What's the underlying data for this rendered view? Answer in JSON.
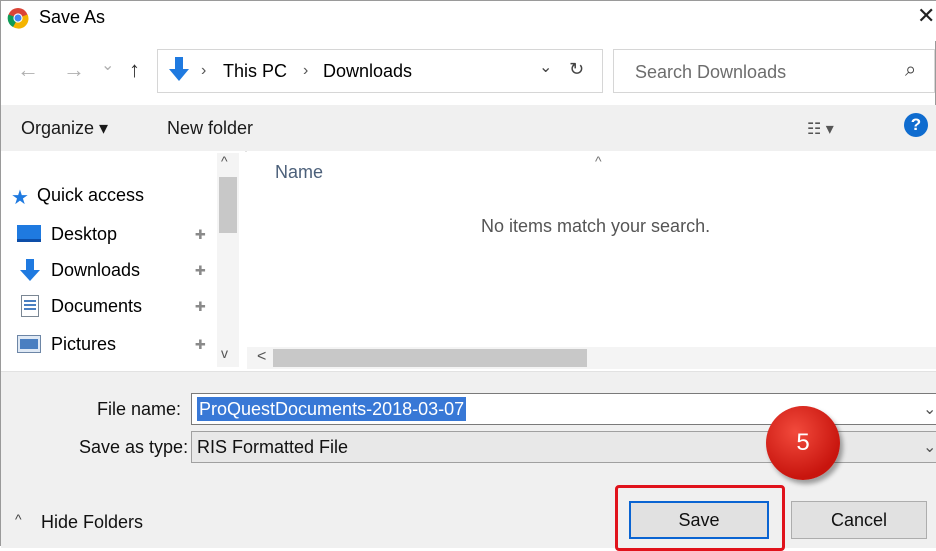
{
  "window": {
    "title": "Save As",
    "close_symbol": "✕"
  },
  "address_bar": {
    "back_symbol": "←",
    "forward_symbol": "→",
    "recent_symbol": "⌄",
    "up_symbol": "↑",
    "breadcrumbs": [
      "This PC",
      "Downloads"
    ],
    "separator": "›",
    "dropdown_symbol": "⌄",
    "refresh_symbol": "↻"
  },
  "search": {
    "placeholder": "Search Downloads",
    "icon": "⌕"
  },
  "toolbar": {
    "organize_label": "Organize ▾",
    "new_folder_label": "New folder",
    "view_symbol": "☷ ▾",
    "help_symbol": "?"
  },
  "nav_pane": {
    "items": [
      {
        "label": "Quick access",
        "icon": "star-icon"
      },
      {
        "label": "Desktop",
        "icon": "desktop-icon"
      },
      {
        "label": "Downloads",
        "icon": "download-arrow-icon"
      },
      {
        "label": "Documents",
        "icon": "document-icon"
      },
      {
        "label": "Pictures",
        "icon": "pictures-icon"
      }
    ],
    "pin_symbol": "📌",
    "scroll_up": "^",
    "scroll_down": "v"
  },
  "content": {
    "column_header": "Name",
    "sort_indicator": "^",
    "empty_message": "No items match your search.",
    "hscroll_left": "<"
  },
  "form": {
    "filename_label": "File name:",
    "filename_value": "ProQuestDocuments-2018-03-07",
    "type_label": "Save as type:",
    "type_value": "RIS Formatted File",
    "dropdown_symbol": "⌄"
  },
  "footer": {
    "hide_folders_label": "Hide Folders",
    "hide_folders_symbol": "^",
    "save_label": "Save",
    "cancel_label": "Cancel"
  },
  "annotation": {
    "step_number": "5",
    "highlight_color": "#e0121b"
  },
  "colors": {
    "accent": "#0a64d2",
    "selection": "#3878d6",
    "folder_blue": "#1f7ae0"
  }
}
